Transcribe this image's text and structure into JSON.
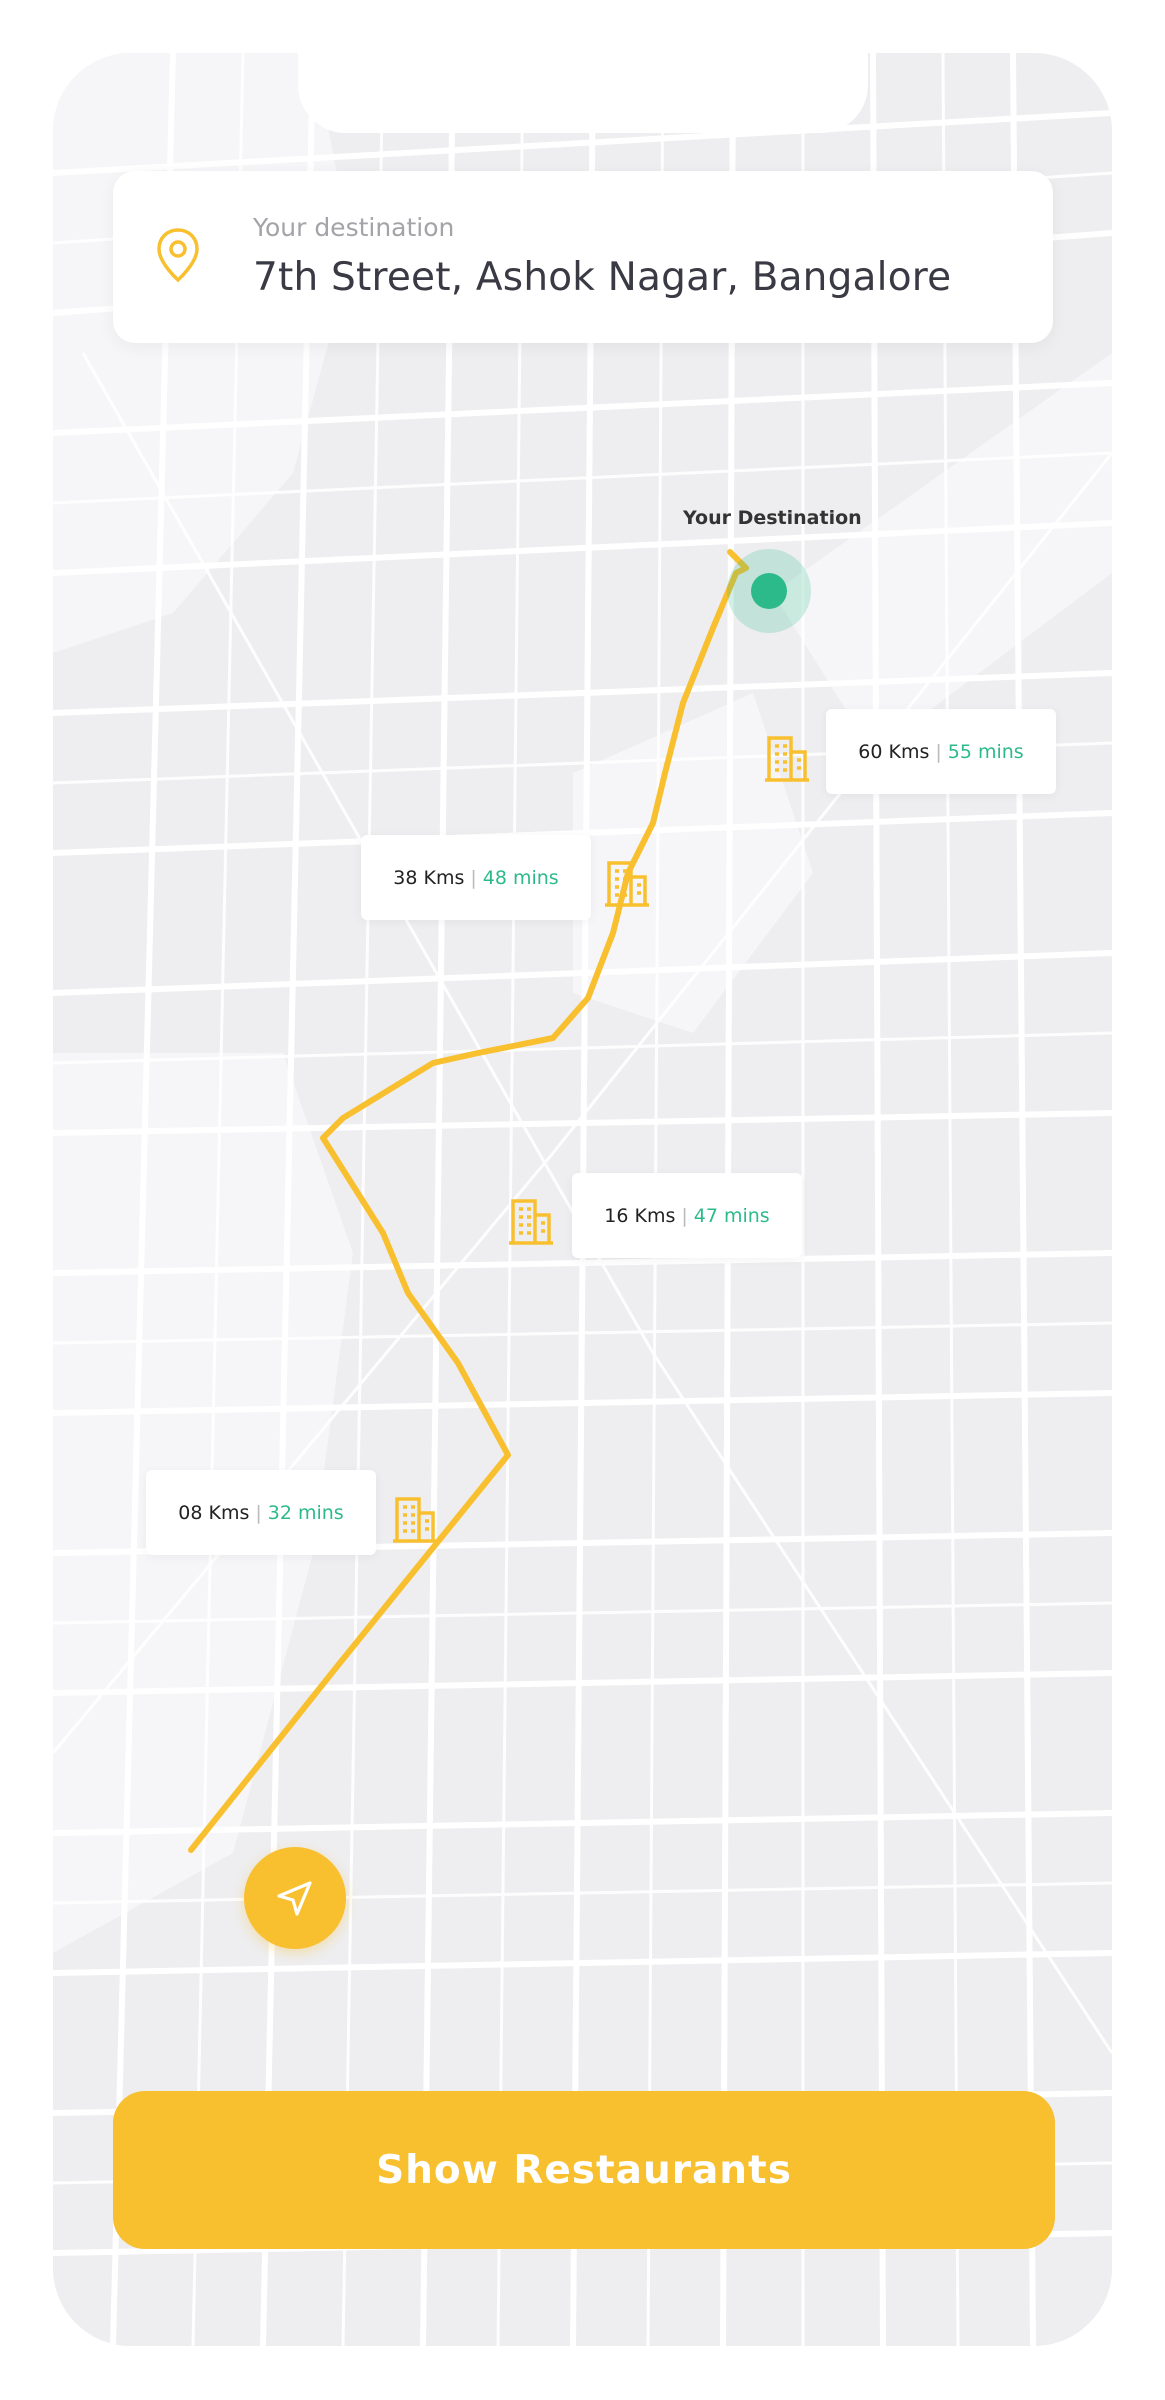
{
  "destination_card": {
    "caption": "Your destination",
    "address": "7th Street, Ashok Nagar, Bangalore",
    "icon": "location-pin-icon"
  },
  "map": {
    "destination_label": "Your Destination",
    "route_color": "#f8bf2f",
    "destination_color": "#2dba8a",
    "stops": [
      {
        "distance": "60 Kms",
        "separator": "|",
        "time": "55 mins",
        "icon": "building-icon"
      },
      {
        "distance": "38 Kms",
        "separator": "|",
        "time": "48 mins",
        "icon": "building-icon"
      },
      {
        "distance": "16 Kms",
        "separator": "|",
        "time": "47 mins",
        "icon": "building-icon"
      },
      {
        "distance": "08 Kms",
        "separator": "|",
        "time": "32 mins",
        "icon": "building-icon"
      }
    ],
    "origin_icon": "navigation-arrow-icon"
  },
  "cta": {
    "label": "Show Restaurants"
  },
  "colors": {
    "accent": "#f8bf2f",
    "green": "#2dba8a",
    "map_background": "#eeeef0",
    "roads": "#ffffff"
  }
}
